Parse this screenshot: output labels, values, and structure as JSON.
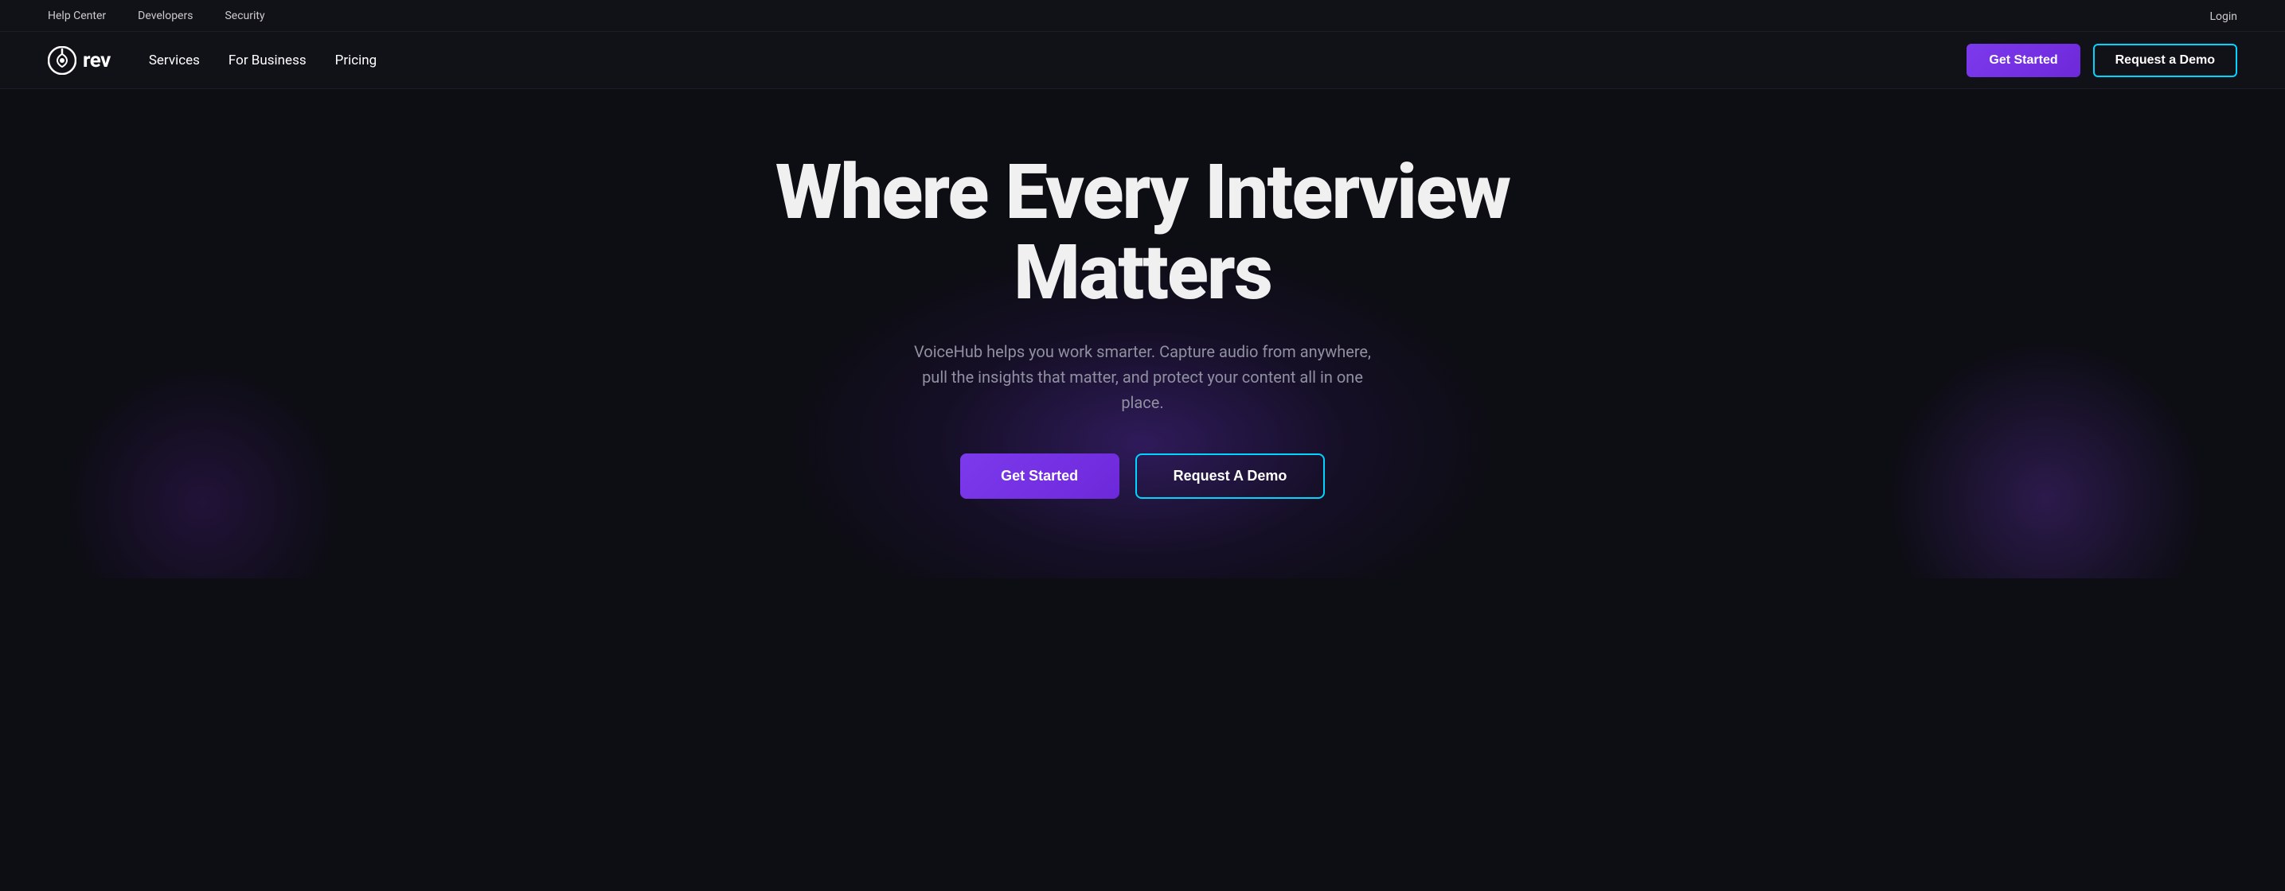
{
  "topBar": {
    "links": [
      {
        "id": "help-center",
        "label": "Help Center"
      },
      {
        "id": "developers",
        "label": "Developers"
      },
      {
        "id": "security",
        "label": "Security"
      }
    ],
    "loginLabel": "Login"
  },
  "nav": {
    "logo": {
      "iconAlt": "rev-logo-icon",
      "text": "rev"
    },
    "links": [
      {
        "id": "services",
        "label": "Services"
      },
      {
        "id": "for-business",
        "label": "For Business"
      },
      {
        "id": "pricing",
        "label": "Pricing"
      }
    ],
    "getStartedLabel": "Get Started",
    "requestDemoLabel": "Request a Demo"
  },
  "hero": {
    "title": "Where Every Interview Matters",
    "subtitle": "VoiceHub helps you work smarter. Capture audio from anywhere, pull the insights that matter, and protect your content all in one place.",
    "getStartedLabel": "Get Started",
    "requestDemoLabel": "Request A Demo",
    "colors": {
      "gradientStart": "#7c3aed",
      "gradientEnd": "#6d28d9",
      "demoBorder": "#00d4ff"
    }
  }
}
